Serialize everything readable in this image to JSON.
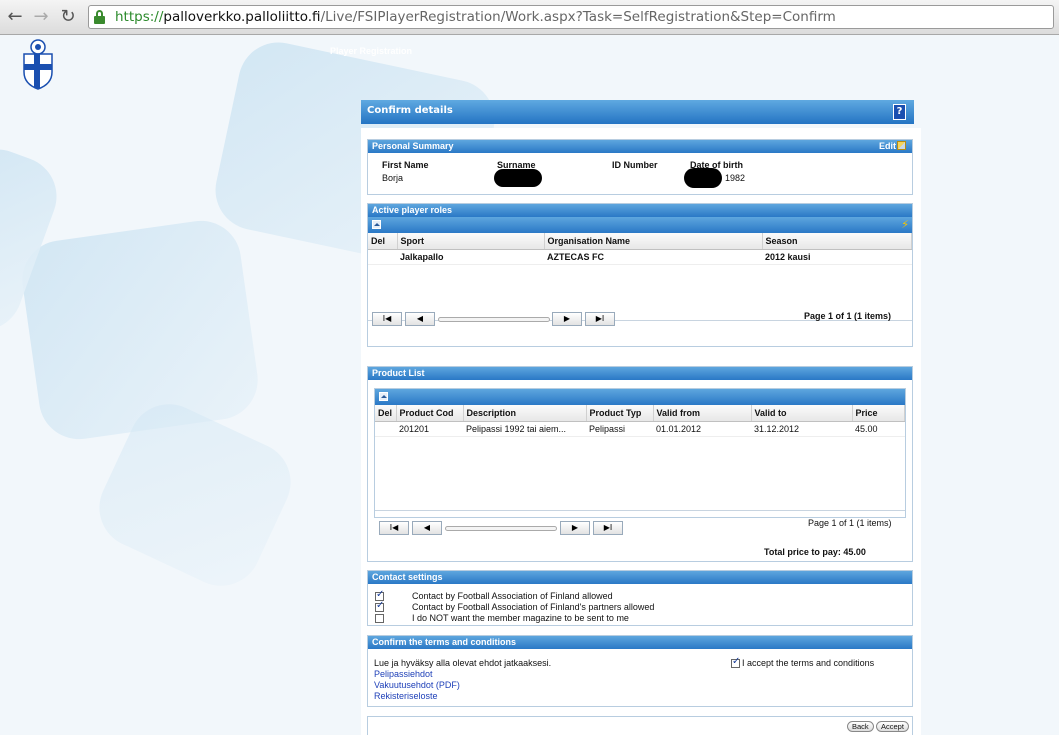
{
  "browser": {
    "url_scheme": "https://",
    "url_host": "palloverkko.palloliitto.fi",
    "url_path": "/Live/FSIPlayerRegistration/Work.aspx?Task=SelfRegistration&Step=Confirm",
    "back_glyph": "←",
    "forward_glyph": "→",
    "reload_glyph": "↻"
  },
  "page": {
    "header_title": "Player Registration"
  },
  "dialog": {
    "title": "Confirm details",
    "help_label": "?"
  },
  "personal": {
    "title": "Personal Summary",
    "edit_label": "Edit",
    "first_name_label": "First Name",
    "surname_label": "Surname",
    "id_label": "ID Number",
    "dob_label": "Date of birth",
    "first_name_value": "Borja",
    "dob_value": "1982"
  },
  "roles": {
    "title": "Active player roles",
    "columns": [
      "Del",
      "Sport",
      "Organisation Name",
      "Season"
    ],
    "rows": [
      {
        "del": "",
        "sport": "Jalkapallo",
        "organisation": "AZTECAS FC",
        "season": "2012 kausi"
      }
    ],
    "page_info": "Page 1 of 1 (1 items)"
  },
  "products": {
    "title": "Product List",
    "columns": [
      "Del",
      "Product Cod",
      "Description",
      "Product Typ",
      "Valid from",
      "Valid to",
      "Price"
    ],
    "rows": [
      {
        "del": "",
        "code": "201201",
        "description": "Pelipassi 1992 tai aiem...",
        "type": "Pelipassi",
        "from": "01.01.2012",
        "to": "31.12.2012",
        "price": "45.00"
      }
    ],
    "page_info": "Page 1 of 1 (1 items)",
    "total": "Total price to pay: 45.00"
  },
  "contact": {
    "title": "Contact settings",
    "items": [
      {
        "label": "Contact by Football Association of Finland allowed",
        "checked": true
      },
      {
        "label": "Contact by Football Association of Finland's partners allowed",
        "checked": true
      },
      {
        "label": "I do NOT want the member magazine to be sent to me",
        "checked": false
      }
    ]
  },
  "terms": {
    "title": "Confirm the terms and conditions",
    "intro": "Lue ja hyväksy alla olevat ehdot jatkaaksesi.",
    "links": [
      "Pelipassiehdot",
      "Vakuutusehdot (PDF)",
      "Rekisteriseloste"
    ],
    "accept_label": "I accept the terms and conditions",
    "accepted": true
  },
  "footer": {
    "back_label": "Back",
    "accept_label": "Accept"
  },
  "pager_glyphs": {
    "first": "I◀",
    "prev": "◀",
    "next": "▶",
    "last": "▶I"
  },
  "colors": {
    "header_blue": "#2a78c6",
    "link_blue": "#1d3fb8",
    "url_green": "#2b8a2b"
  }
}
